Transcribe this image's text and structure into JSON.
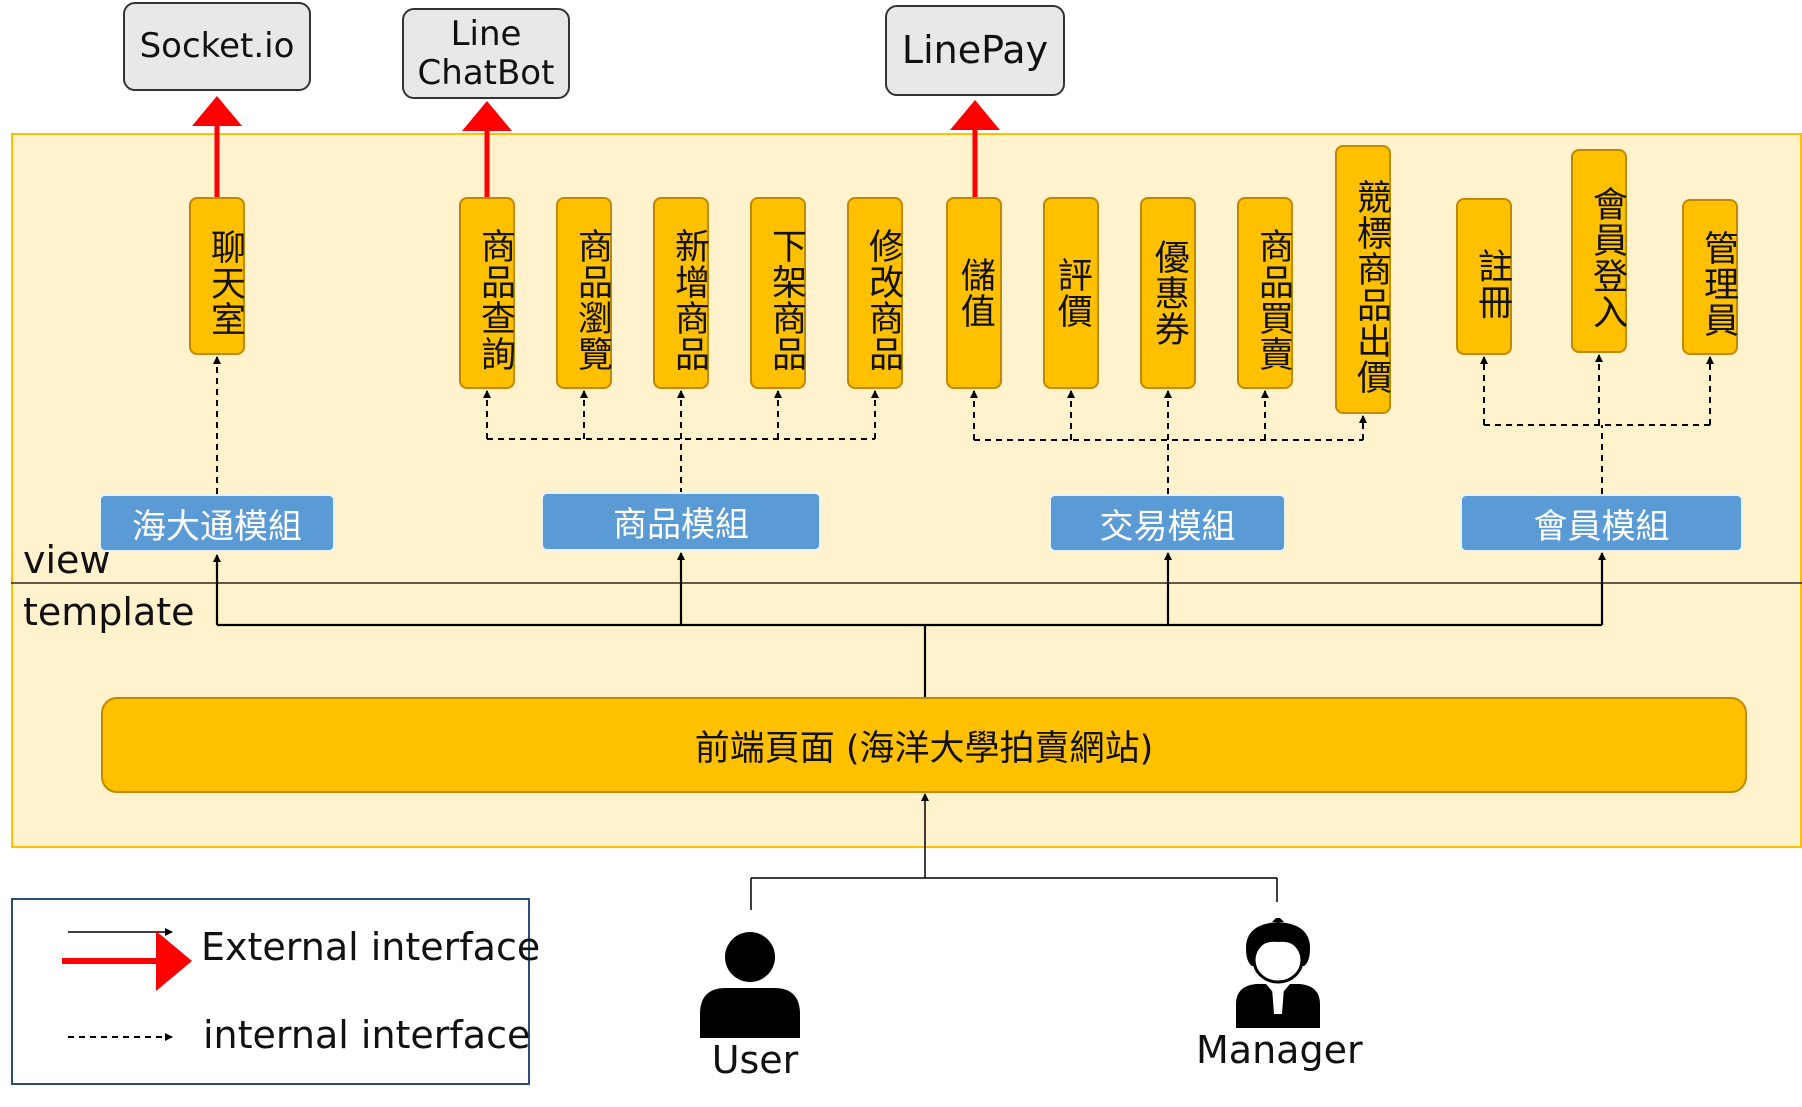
{
  "external": {
    "socketio": "Socket.io",
    "line_chatbot": "Line\nChatBot",
    "linepay": "LinePay"
  },
  "features": {
    "chat_room": "聊天室",
    "product_search": "商品查詢",
    "product_browse": "商品瀏覽",
    "add_product": "新增商品",
    "remove_product": "下架商品",
    "edit_product": "修改商品",
    "top_up": "儲值",
    "review": "評價",
    "coupon": "優惠券",
    "product_trade": "商品買賣",
    "auction_bid": "競標商品出價",
    "register": "註冊",
    "member_login": "會員登入",
    "admin": "管理員"
  },
  "modules": {
    "haida": "海大通模組",
    "product": "商品模組",
    "trade": "交易模組",
    "member": "會員模組"
  },
  "layers": {
    "view": "view",
    "template": "template"
  },
  "frontend": "前端頁面 (海洋大學拍賣網站)",
  "actors": {
    "user": "User",
    "manager": "Manager"
  },
  "legend": {
    "external": "External interface",
    "internal": "internal interface"
  },
  "colors": {
    "panel_bg": "#fff2cc",
    "panel_border": "#ffc000",
    "feature_fill": "#ffc000",
    "module_fill": "#5b9bd5",
    "external_fill": "#e8e8e8",
    "external_arrow": "#ff0000",
    "legend_border": "#2f4d7a"
  }
}
